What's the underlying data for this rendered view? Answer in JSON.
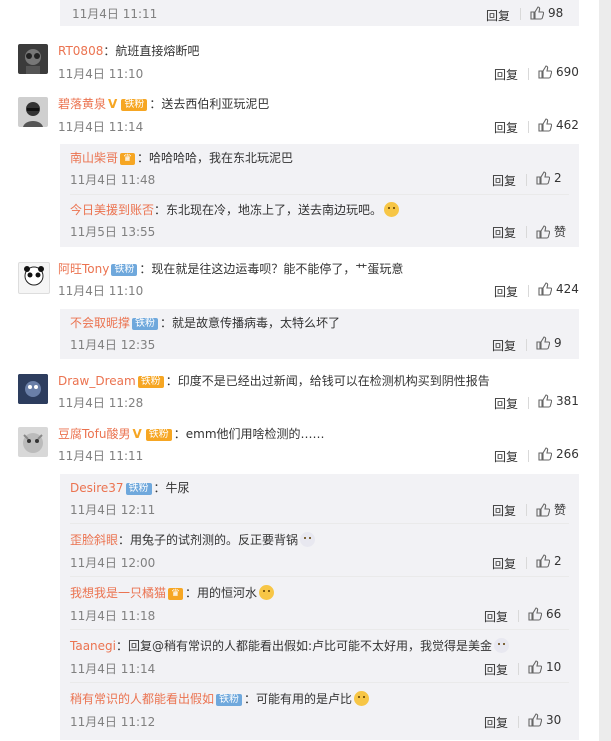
{
  "labels": {
    "reply": "回复",
    "colon": "："
  },
  "top_partial": {
    "time": "11月4日 11:11",
    "likes": "98"
  },
  "comments": [
    {
      "name": "RT0808",
      "text": "航班直接熔断吧",
      "time": "11月4日 11:10",
      "likes": "690"
    },
    {
      "name": "碧落黄泉",
      "badge_text": "铁粉",
      "text": "送去西伯利亚玩泥巴",
      "time": "11月4日 11:14",
      "likes": "462",
      "replies": [
        {
          "name": "南山柴哥",
          "text": "哈哈哈哈，我在东北玩泥巴",
          "time": "11月4日 11:48",
          "likes": "2"
        },
        {
          "name": "今日美援到账否",
          "text": "东北现在冷，地冻上了，送去南边玩吧。",
          "time": "11月5日 13:55",
          "likes": "赞"
        }
      ]
    },
    {
      "name": "阿旺Tony",
      "badge_text": "铁粉",
      "text": "现在就是往这边运毒呗？能不能停了，艹蛋玩意",
      "time": "11月4日 11:10",
      "likes": "424",
      "replies": [
        {
          "name": "不会取昵撑",
          "badge_text": "铁粉",
          "text": "就是故意传播病毒，太特么坏了",
          "time": "11月4日 12:35",
          "likes": "9"
        }
      ]
    },
    {
      "name": "Draw_Dream",
      "badge_text": "铁粉",
      "text": "印度不是已经出过新闻，给钱可以在检测机构买到阴性报告",
      "time": "11月4日 11:28",
      "likes": "381"
    },
    {
      "name": "豆腐Tofu酸男",
      "badge_text": "铁粉",
      "text": "emm他们用啥检测的……",
      "time": "11月4日 11:11",
      "likes": "266",
      "replies": [
        {
          "name": "Desire37",
          "badge_text": "铁粉",
          "text": "牛尿",
          "time": "11月4日 12:11",
          "likes": "赞"
        },
        {
          "name": "歪脸斜眼",
          "text": "用兔子的试剂测的。反正要背锅",
          "time": "11月4日 12:00",
          "likes": "2"
        },
        {
          "name": "我想我是一只橘猫",
          "text": "用的恒河水",
          "time": "11月4日 11:18",
          "likes": "66"
        },
        {
          "name": "Taanegi",
          "text": "回复@稍有常识的人都能看出假如:卢比可能不太好用，我觉得是美金",
          "time": "11月4日 11:14",
          "likes": "10"
        },
        {
          "name": "稍有常识的人都能看出假如",
          "badge_text": "铁粉",
          "text": "可能有用的是卢比",
          "time": "11月4日 11:12",
          "likes": "30"
        }
      ]
    }
  ]
}
